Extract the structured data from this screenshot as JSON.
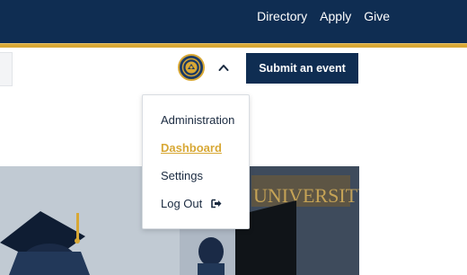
{
  "header": {
    "nav": [
      {
        "label": "Directory"
      },
      {
        "label": "Apply"
      },
      {
        "label": "Give"
      }
    ],
    "brand_color": "#0f2d52",
    "accent_color": "#d8a835"
  },
  "toolbar": {
    "submit_label": "Submit an event",
    "avatar_icon": "university-seal-icon",
    "toggle_icon": "chevron-up-icon"
  },
  "user_menu": {
    "items": [
      {
        "label": "Administration",
        "active": false
      },
      {
        "label": "Dashboard",
        "active": true
      },
      {
        "label": "Settings",
        "active": false
      },
      {
        "label": "Log Out",
        "icon": "sign-out-icon",
        "active": false
      }
    ]
  },
  "hero": {
    "banner_text": "UNIVERSITY OF CALIFORNIA MERCED"
  }
}
